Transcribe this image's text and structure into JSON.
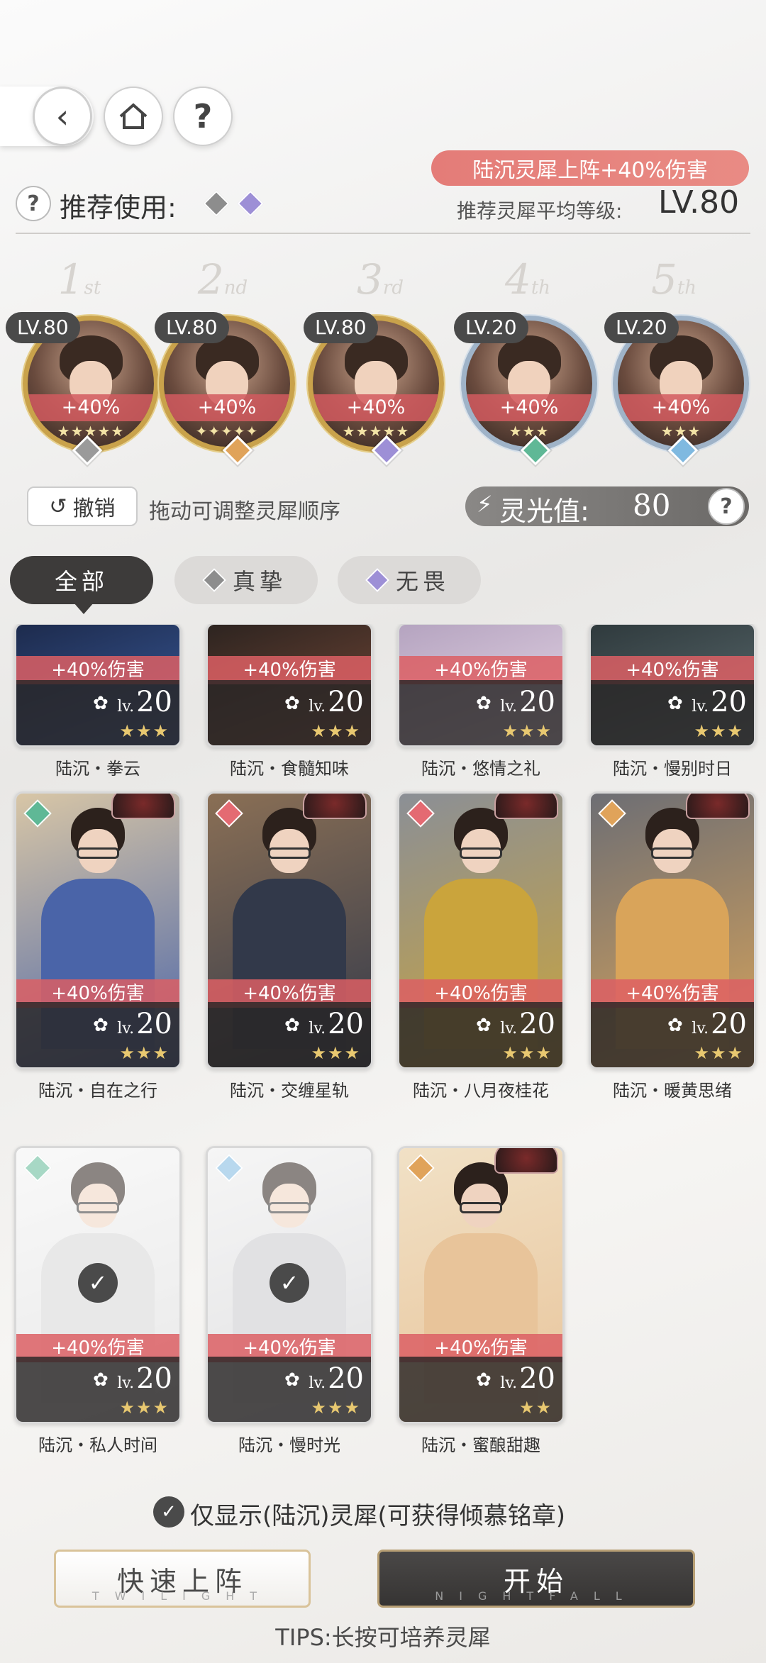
{
  "header": {
    "recommend_label": "推荐使用:",
    "hint_badge": "陆沉灵犀上阵+40%伤害",
    "avg_level_label": "推荐灵犀平均等级:",
    "avg_level_value": "LV.80"
  },
  "ranks": [
    {
      "num": "1",
      "suf": "st"
    },
    {
      "num": "2",
      "suf": "nd"
    },
    {
      "num": "3",
      "suf": "rd"
    },
    {
      "num": "4",
      "suf": "th"
    },
    {
      "num": "5",
      "suf": "th"
    }
  ],
  "slots": [
    {
      "level": "LV.80",
      "bonus": "+40%",
      "stars": "★★★★★",
      "frame": "gold",
      "gem_color": "#9a9a9a"
    },
    {
      "level": "LV.80",
      "bonus": "+40%",
      "stars": "✦✦✦✦✦",
      "frame": "gold",
      "gem_color": "#e0a35a"
    },
    {
      "level": "LV.80",
      "bonus": "+40%",
      "stars": "★★★★★",
      "frame": "gold",
      "gem_color": "#9d8fd6"
    },
    {
      "level": "LV.20",
      "bonus": "+40%",
      "stars": "★★★",
      "frame": "silver",
      "gem_color": "#5fb896"
    },
    {
      "level": "LV.20",
      "bonus": "+40%",
      "stars": "★★★",
      "frame": "silver",
      "gem_color": "#7fb9e0"
    }
  ],
  "controls": {
    "undo_label": "撤销",
    "drag_hint": "拖动可调整灵犀顺序",
    "energy_label": "灵光值:",
    "energy_value": "80"
  },
  "tabs": [
    {
      "label": "全部",
      "active": true
    },
    {
      "label": "真挚",
      "active": false
    },
    {
      "label": "无畏",
      "active": false
    }
  ],
  "cards": [
    {
      "name": "陆沉・拳云",
      "bonus": "+40%伤害",
      "level": "20",
      "lv_prefix": "lv.",
      "stars": "★★★"
    },
    {
      "name": "陆沉・食髓知味",
      "bonus": "+40%伤害",
      "level": "20",
      "lv_prefix": "lv.",
      "stars": "★★★"
    },
    {
      "name": "陆沉・悠情之礼",
      "bonus": "+40%伤害",
      "level": "20",
      "lv_prefix": "lv.",
      "stars": "★★★"
    },
    {
      "name": "陆沉・慢别时日",
      "bonus": "+40%伤害",
      "level": "20",
      "lv_prefix": "lv.",
      "stars": "★★★"
    },
    {
      "name": "陆沉・自在之行",
      "bonus": "+40%伤害",
      "level": "20",
      "lv_prefix": "lv.",
      "stars": "★★★"
    },
    {
      "name": "陆沉・交缠星轨",
      "bonus": "+40%伤害",
      "level": "20",
      "lv_prefix": "lv.",
      "stars": "★★★"
    },
    {
      "name": "陆沉・八月夜桂花",
      "bonus": "+40%伤害",
      "level": "20",
      "lv_prefix": "lv.",
      "stars": "★★★"
    },
    {
      "name": "陆沉・暖黄思绪",
      "bonus": "+40%伤害",
      "level": "20",
      "lv_prefix": "lv.",
      "stars": "★★★"
    },
    {
      "name": "陆沉・私人时间",
      "bonus": "+40%伤害",
      "level": "20",
      "lv_prefix": "lv.",
      "stars": "★★★"
    },
    {
      "name": "陆沉・慢时光",
      "bonus": "+40%伤害",
      "level": "20",
      "lv_prefix": "lv.",
      "stars": "★★★"
    },
    {
      "name": "陆沉・蜜酿甜趣",
      "bonus": "+40%伤害",
      "level": "20",
      "lv_prefix": "lv.",
      "stars": "★★"
    }
  ],
  "filter": {
    "label": "仅显示(陆沉)灵犀(可获得倾慕铭章)",
    "checked": true
  },
  "buttons": {
    "quick_label": "快速上阵",
    "quick_sub": "TWILIGHT",
    "start_label": "开始",
    "start_sub": "NIGHTFALL"
  },
  "tips": "TIPS:长按可培养灵犀",
  "colors": {
    "accent_red": "#e47c78",
    "dark": "#3d3b3a"
  }
}
